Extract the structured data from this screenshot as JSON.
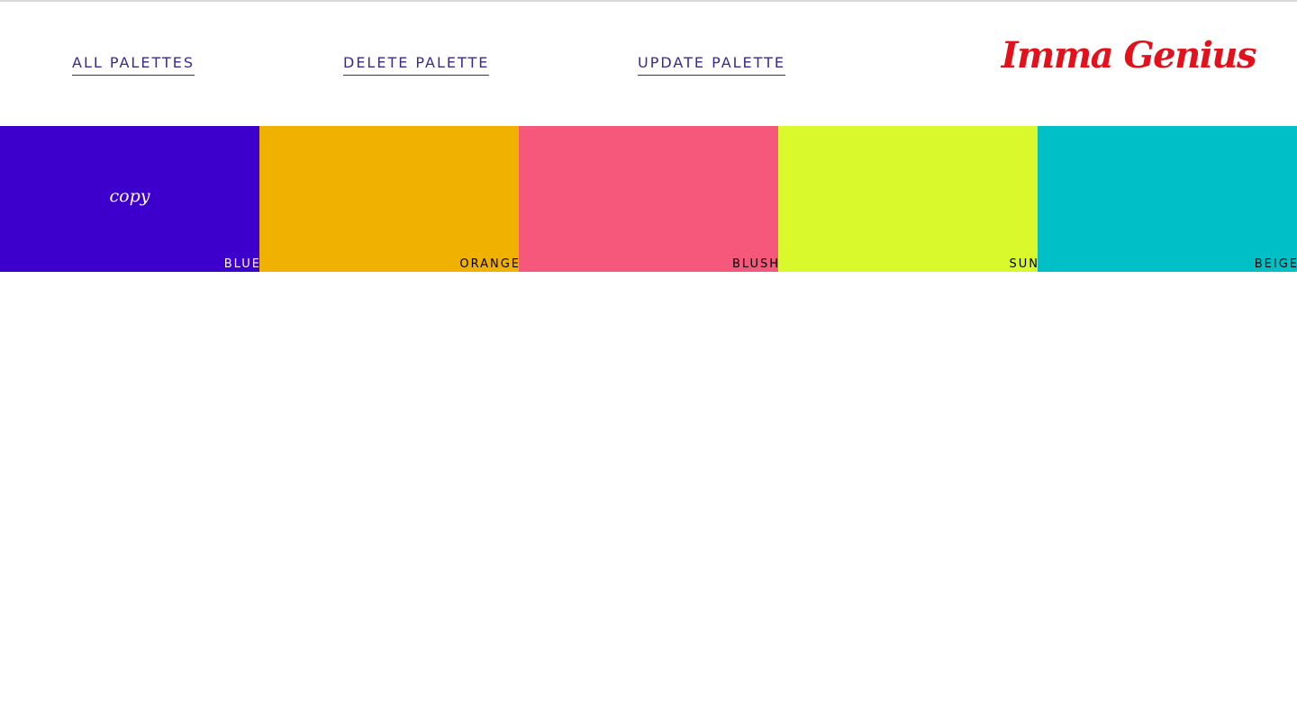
{
  "nav": {
    "all_palettes": "ALL PALETTES",
    "delete_palette": "DELETE PALETTE",
    "update_palette": "UPDATE PALETTE"
  },
  "brand": "Imma Genius",
  "colors": {
    "nav_link": "#3b2a8c",
    "brand": "#e1121b"
  },
  "palette": {
    "swatches": [
      {
        "name": "BLUE",
        "color": "#3d00cc",
        "text_color": "#ffffff",
        "hover_label": "copy"
      },
      {
        "name": "ORANGE",
        "color": "#f1b100",
        "text_color": "#000000"
      },
      {
        "name": "BLUSH",
        "color": "#f5587b",
        "text_color": "#000000"
      },
      {
        "name": "SUN",
        "color": "#daf92d",
        "text_color": "#000000"
      },
      {
        "name": "BEIGE",
        "color": "#00bfc6",
        "text_color": "#000000"
      }
    ]
  }
}
